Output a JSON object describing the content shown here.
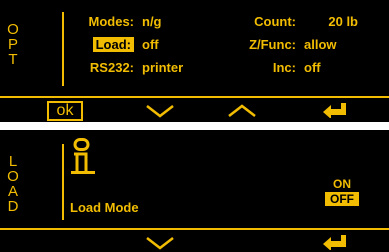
{
  "opt_panel": {
    "side_title": [
      "O",
      "P",
      "T"
    ],
    "rows": [
      {
        "label": "Modes:",
        "value": "n/g",
        "selected": false
      },
      {
        "label": "Load:",
        "value": "off",
        "selected": true
      },
      {
        "label": "RS232:",
        "value": "printer",
        "selected": false
      }
    ],
    "right_rows": [
      {
        "label": "Count:",
        "value": "20 lb"
      },
      {
        "label": "Z/Func:",
        "value": "allow"
      },
      {
        "label": "Inc:",
        "value": "off"
      }
    ],
    "softkeys": {
      "ok_label": "ok",
      "down_icon": "chevron-down-icon",
      "up_icon": "chevron-up-icon",
      "enter_icon": "enter-arrow-icon"
    }
  },
  "load_panel": {
    "side_title": [
      "L",
      "O",
      "A",
      "D"
    ],
    "icon": "info-icon",
    "mode_title": "Load Mode",
    "options": [
      {
        "label": "ON",
        "selected": false
      },
      {
        "label": "OFF",
        "selected": true
      }
    ],
    "softkeys": {
      "down_icon": "chevron-down-icon",
      "enter_icon": "enter-arrow-icon"
    }
  },
  "colors": {
    "background": "#000000",
    "accent": "#f2bd00",
    "page": "#ffffff"
  }
}
